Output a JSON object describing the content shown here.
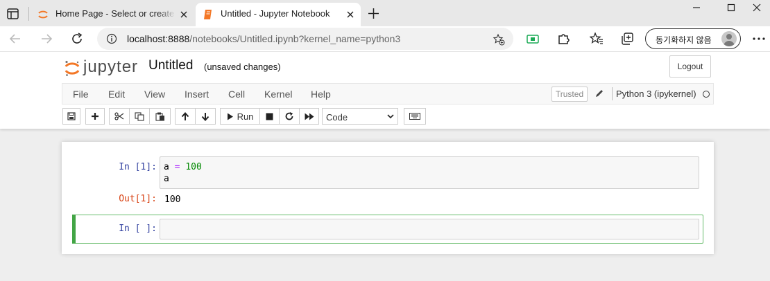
{
  "browser": {
    "tabs": [
      {
        "title": "Home Page - Select or create a notebook",
        "active": false
      },
      {
        "title": "Untitled - Jupyter Notebook",
        "active": true
      }
    ],
    "url_host": "localhost:8888",
    "url_path": "/notebooks/Untitled.ipynb?kernel_name=python3",
    "sync_label": "동기화하지 않음",
    "colors": {
      "accent": "#1a73e8",
      "extension": "#1aaa55"
    }
  },
  "jupyter": {
    "logo_text": "jupyter",
    "notebook_name": "Untitled",
    "save_status": "(unsaved changes)",
    "logout_label": "Logout",
    "menu": [
      "File",
      "Edit",
      "View",
      "Insert",
      "Cell",
      "Kernel",
      "Help"
    ],
    "trusted_label": "Trusted",
    "kernel_name": "Python 3 (ipykernel)",
    "toolbar": {
      "run_label": "Run",
      "cell_type": "Code"
    },
    "colors": {
      "logo_orange": "#f37726",
      "selected_cell": "#42a545",
      "in_prompt": "#303f9f",
      "out_prompt": "#d84315"
    }
  },
  "cells": [
    {
      "in_prompt": "In [1]:",
      "code_line1_var": "a",
      "code_line1_op": "=",
      "code_line1_num": "100",
      "code_line2": "a",
      "out_prompt": "Out[1]:",
      "output": "100"
    },
    {
      "in_prompt": "In [ ]:",
      "code": ""
    }
  ]
}
